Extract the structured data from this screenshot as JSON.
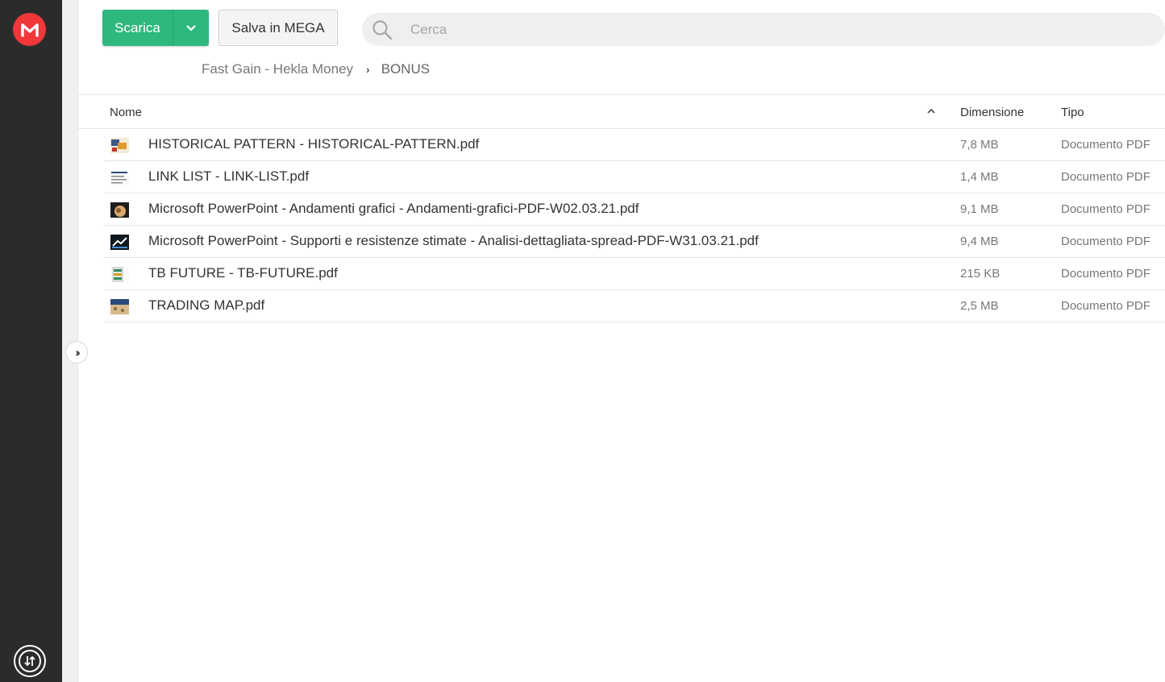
{
  "sidebar": {
    "logo_letter": "M",
    "transfer_icon": "transfer-icon"
  },
  "toolbar": {
    "download_label": "Scarica",
    "save_label": "Salva in MEGA",
    "search_placeholder": "Cerca"
  },
  "breadcrumb": {
    "parent": "Fast Gain - Hekla Money",
    "current": "BONUS"
  },
  "table": {
    "headers": {
      "name": "Nome",
      "size": "Dimensione",
      "type": "Tipo"
    },
    "rows": [
      {
        "name": "HISTORICAL PATTERN - HISTORICAL-PATTERN.pdf",
        "size": "7,8 MB",
        "type": "Documento PDF"
      },
      {
        "name": "LINK LIST - LINK-LIST.pdf",
        "size": "1,4 MB",
        "type": "Documento PDF"
      },
      {
        "name": "Microsoft PowerPoint - Andamenti grafici - Andamenti-grafici-PDF-W02.03.21.pdf",
        "size": "9,1 MB",
        "type": "Documento PDF"
      },
      {
        "name": "Microsoft PowerPoint - Supporti e resistenze stimate - Analisi-dettagliata-spread-PDF-W31.03.21.pdf",
        "size": "9,4 MB",
        "type": "Documento PDF"
      },
      {
        "name": "TB FUTURE - TB-FUTURE.pdf",
        "size": "215 KB",
        "type": "Documento PDF"
      },
      {
        "name": "TRADING MAP.pdf",
        "size": "2,5 MB",
        "type": "Documento PDF"
      }
    ]
  },
  "colors": {
    "accent_green": "#2eb87e",
    "brand_red": "#f0373a",
    "sidebar_bg": "#2b2b2b"
  }
}
